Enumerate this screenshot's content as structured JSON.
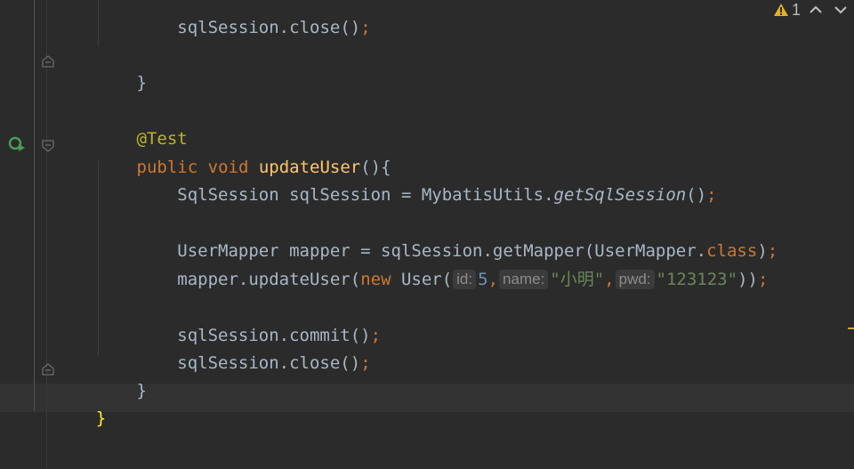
{
  "toolbar": {
    "warning_icon": "warning-triangle-icon",
    "warning_count": "1",
    "prev_icon": "chevron-up-icon",
    "next_icon": "chevron-down-icon"
  },
  "colors": {
    "keyword": "#cc7832",
    "method": "#ffc66d",
    "annotation": "#bbb529",
    "string": "#6a8759",
    "number": "#6897bb",
    "text": "#a9b7c6",
    "hint_bg": "#3b3b3b",
    "brace_highlight": "#ffef28"
  },
  "gutter": {
    "run_icon": "run-test-icon"
  },
  "code": {
    "l1": {
      "recv": "sqlSession",
      "dot": ".",
      "method": "close",
      "paren": "()",
      "semi": ";"
    },
    "l2": {
      "brace": "}"
    },
    "l3": {
      "annotation": "@Test"
    },
    "l4": {
      "kw1": "public",
      "kw2": "void",
      "name": "updateUser",
      "rest": "(){"
    },
    "l5": {
      "a": "SqlSession sqlSession = MybatisUtils.",
      "method": "getSqlSession",
      "b": "()",
      "semi": ";"
    },
    "l6": {
      "a": "UserMapper mapper = sqlSession.getMapper(UserMapper.",
      "kw": "class",
      "b": ")",
      "semi": ";"
    },
    "l7": {
      "a": "mapper.updateUser(",
      "kw": "new",
      "b": " User(",
      "hint1": "id:",
      "num": "5",
      "c1": ",",
      "hint2": "name:",
      "str1": "\"小明\"",
      "c2": ",",
      "hint3": "pwd:",
      "str2": "\"123123\"",
      "end": "))",
      "semi": ";"
    },
    "l8": {
      "a": "sqlSession.commit()",
      "semi": ";"
    },
    "l9": {
      "a": "sqlSession.close()",
      "semi": ";"
    },
    "l10": {
      "brace": "}"
    },
    "l11": {
      "brace": "}"
    }
  }
}
